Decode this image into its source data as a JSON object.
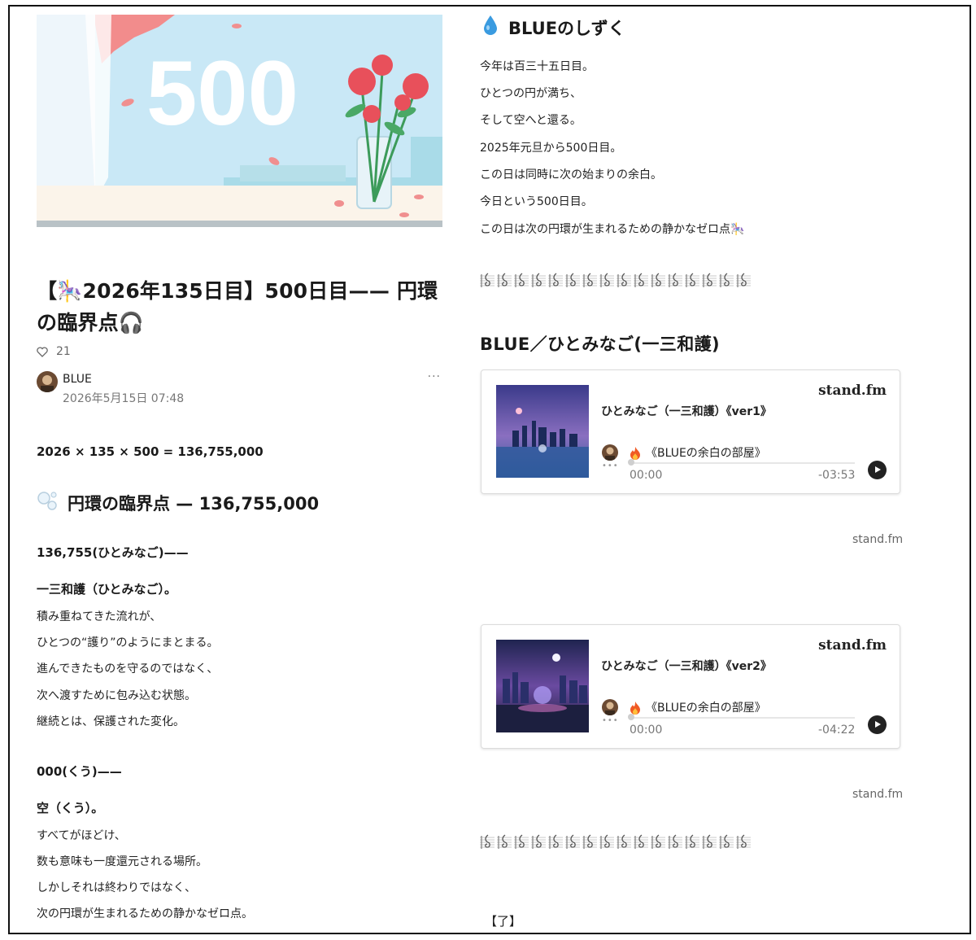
{
  "hero": {
    "number_text": "500"
  },
  "article": {
    "title": "【🎠2026年135日目】500日目—— 円環の臨界点🎧",
    "likes": "21",
    "author": "BLUE",
    "date": "2026年5月15日 07:48",
    "more": "···",
    "formula": "2026 × 135 × 500 = 136,755,000",
    "section_title": "円環の臨界点 — 136,755,000",
    "block1_head": "136,755(ひとみなご)——",
    "block1_sub": "一三和護（ひとみなご）。",
    "block1_lines": [
      "積み重ねてきた流れが、",
      "ひとつの“護り”のようにまとまる。",
      "進んできたものを守るのではなく、",
      "次へ渡すために包み込む状態。",
      "継続とは、保護された変化。"
    ],
    "block2_head": "000(くう)——",
    "block2_sub": "空（くう）。",
    "block2_lines": [
      "すべてがほどけ、",
      "数も意味も一度還元される場所。",
      "しかしそれは終わりではなく、",
      "次の円環が生まれるための静かなゼロ点。"
    ]
  },
  "right": {
    "drop_title": "BLUEのしずく",
    "lines": [
      "今年は百三十五日目。",
      "ひとつの円が満ち、",
      "そして空へと還る。",
      "2025年元旦から500日目。",
      "この日は同時に次の始まりの余白。",
      "今日という500日目。",
      "この日は次の円環が生まれるための静かなゼロ点🎠"
    ],
    "song_heading": "BLUE／ひとみなご(一三和護)",
    "cards": [
      {
        "brand": "stand.fm",
        "track": "ひとみなご（一三和護）《ver1》",
        "channel": "《BLUEの余白の部屋》",
        "start": "00:00",
        "end": "-03:53",
        "source": "stand.fm"
      },
      {
        "brand": "stand.fm",
        "track": "ひとみなご（一三和護）《ver2》",
        "channel": "《BLUEの余白の部屋》",
        "start": "00:00",
        "end": "-04:22",
        "source": "stand.fm"
      }
    ],
    "end_mark": "【了】"
  }
}
